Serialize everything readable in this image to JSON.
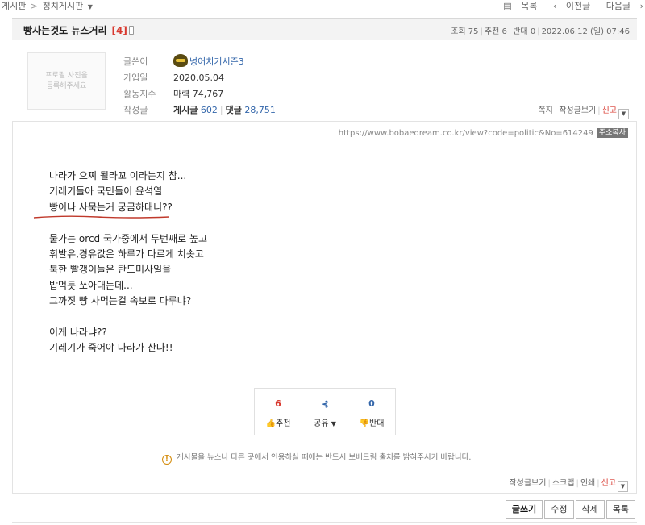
{
  "breadcrumb": {
    "root": "게시판",
    "separator": ">",
    "current": "정치게시판",
    "dropdown": "▼"
  },
  "topnav": {
    "list": "목록",
    "prev": "이전글",
    "next": "다음글"
  },
  "post": {
    "title": "빵사는것도 뉴스거리",
    "comment_count": "[4]",
    "stats": {
      "views": "조회 75",
      "recommends": "추천 6",
      "opposes": "반대 0",
      "datetime": "2022.06.12 (일) 07:46"
    }
  },
  "author": {
    "photo_placeholder_line1": "프로필 사진을",
    "photo_placeholder_line2": "등록해주세요",
    "labels": {
      "writer": "글쓴이",
      "joined": "가입일",
      "activity": "활동지수",
      "posts": "작성글"
    },
    "nickname": "넝어치기시즌3",
    "joined": "2020.05.04",
    "activity": "마력 74,767",
    "posts_label": "게시글",
    "posts_count": "602",
    "comments_label": "댓글",
    "comments_count": "28,751",
    "actions": {
      "message": "쪽지",
      "view_posts": "작성글보기",
      "report": "신고"
    }
  },
  "url": {
    "text": "https://www.bobaedream.co.kr/view?code=politic&No=614249",
    "copy_label": "주소복사"
  },
  "content": {
    "lines_1": [
      "나라가 으찌 될라꼬 이라는지 참...",
      "기레기들아 국민들이 윤석열",
      "빵이나 사묵는거 궁금하대니??"
    ],
    "lines_2": [
      "물가는 orcd 국가중에서 두번째로 높고",
      "휘발유,경유값은 하루가 다르게 치솟고",
      "북한 빨갱이들은 탄도미사일을",
      "밥먹듯 쏘아대는데...",
      "그까짓 빵 사먹는걸 속보로 다루냐?"
    ],
    "lines_3": [
      "이게 나라냐??",
      "기레기가 죽어야 나라가 산다!!"
    ]
  },
  "votes": {
    "up_count": "6",
    "up_label": "추천",
    "share_label": "공유",
    "share_dropdown": "▼",
    "down_count": "0",
    "down_label": "반대"
  },
  "notice": "게시물을 뉴스나 다른 곳에서 인용하실 때에는 반드시 보배드림 출처를 밝혀주시기 바랍니다.",
  "bottom_actions": {
    "view_posts": "작성글보기",
    "scrap": "스크랩",
    "print": "인쇄",
    "report": "신고"
  },
  "buttons": {
    "write": "글쓰기",
    "edit": "수정",
    "delete": "삭제",
    "list": "목록"
  }
}
